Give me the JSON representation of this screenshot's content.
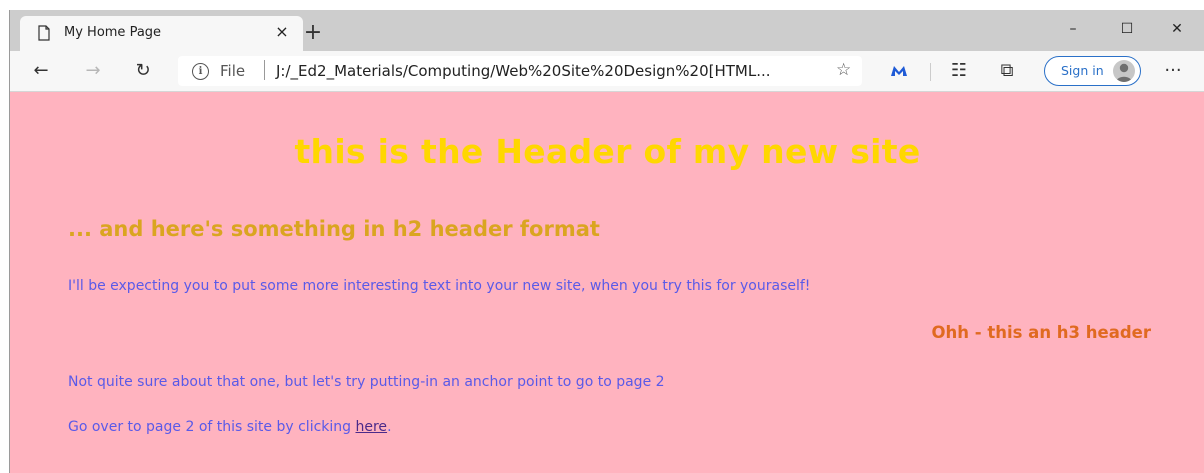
{
  "browser": {
    "tab": {
      "title": "My Home Page",
      "close_glyph": "×"
    },
    "new_tab_glyph": "+",
    "window_controls": {
      "minimize": "–",
      "maximize": "☐",
      "close": "✕"
    },
    "toolbar": {
      "back_glyph": "←",
      "forward_glyph": "→",
      "refresh_glyph": "↻",
      "scheme": "File",
      "url": "J:/_Ed2_Materials/Computing/Web%20Site%20Design%20[HTML...",
      "favorite_glyph": "☆",
      "collections_glyph": "☷",
      "tab_actions_glyph": "⧉",
      "sign_in_label": "Sign in",
      "more_glyph": "···"
    }
  },
  "page": {
    "h1": "this is the Header of my new site",
    "h2": "... and here's something in h2 header format",
    "intro": "I'll be expecting you to put some more interesting text into your new site, when you try this for youraself!",
    "h3": "Ohh - this an h3 header",
    "anchor_note": "Not quite sure about that one, but let's try putting-in an anchor point to go to page 2",
    "go_prefix": "Go over to page 2 of this site by clicking ",
    "go_link": "here",
    "go_suffix": "."
  },
  "colors": {
    "page_background": "#ffb3bf",
    "h1": "#ffd700",
    "h2": "#daa520",
    "h3": "#e06a20",
    "body_text": "#5a5ae8",
    "link": "#4b2a8a",
    "sign_in_accent": "#2a70c8"
  },
  "icons": {
    "tab_page": "page-icon",
    "security": "info-icon",
    "extension": "extension-icon"
  }
}
